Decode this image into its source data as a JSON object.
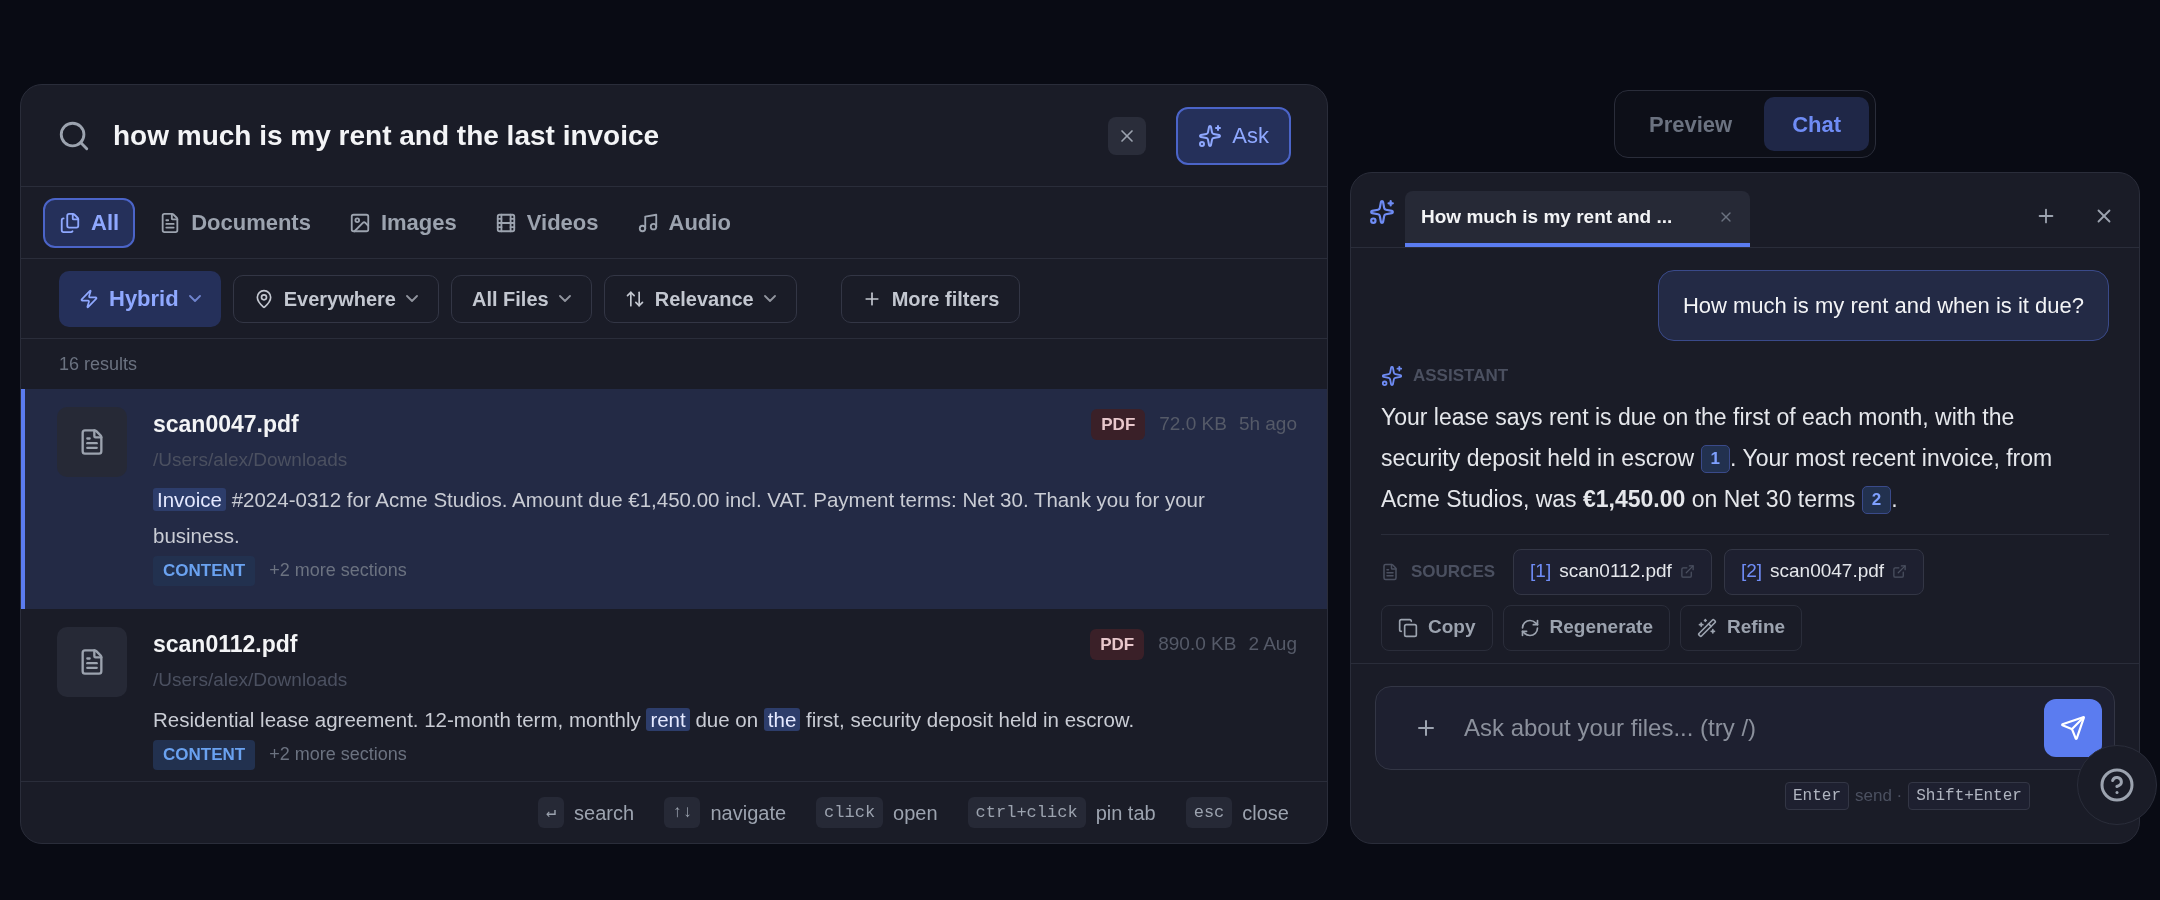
{
  "search": {
    "query": "how much is my rent and the last invoice",
    "ask_label": "Ask"
  },
  "type_tabs": [
    {
      "label": "All",
      "selected": true
    },
    {
      "label": "Documents",
      "selected": false
    },
    {
      "label": "Images",
      "selected": false
    },
    {
      "label": "Videos",
      "selected": false
    },
    {
      "label": "Audio",
      "selected": false
    }
  ],
  "filters": [
    {
      "label": "Hybrid",
      "kind": "dropdown",
      "selected": true
    },
    {
      "label": "Everywhere",
      "kind": "dropdown",
      "selected": false
    },
    {
      "label": "All Files",
      "kind": "dropdown",
      "selected": false
    },
    {
      "label": "Relevance",
      "kind": "dropdown",
      "selected": false
    },
    {
      "label": "More filters",
      "kind": "button",
      "selected": false
    }
  ],
  "result_count": "16 results",
  "results": [
    {
      "name": "scan0047.pdf",
      "path": "/Users/alex/Downloads",
      "type": "PDF",
      "size": "72.0 KB",
      "date": "5h ago",
      "selected": true,
      "snippet": [
        {
          "text": "Invoice",
          "highlight": true
        },
        {
          "text": " #2024-0312 for Acme Studios. Amount due €1,450.00 incl. VAT. Payment terms: Net 30. Thank you for your business.",
          "highlight": false
        }
      ],
      "tag": "CONTENT",
      "more": "+2 more sections"
    },
    {
      "name": "scan0112.pdf",
      "path": "/Users/alex/Downloads",
      "type": "PDF",
      "size": "890.0 KB",
      "date": "2 Aug",
      "selected": false,
      "snippet": [
        {
          "text": "Residential lease agreement. 12-month term, monthly ",
          "highlight": false
        },
        {
          "text": "rent",
          "highlight": true
        },
        {
          "text": " due on ",
          "highlight": false
        },
        {
          "text": "the",
          "highlight": true
        },
        {
          "text": " first, security deposit held in escrow.",
          "highlight": false
        }
      ],
      "tag": "CONTENT",
      "more": "+2 more sections"
    }
  ],
  "shortcuts": [
    {
      "key": "↵",
      "label": "search"
    },
    {
      "key": "↑↓",
      "label": "navigate"
    },
    {
      "key": "click",
      "label": "open"
    },
    {
      "key": "ctrl+click",
      "label": "pin tab"
    },
    {
      "key": "esc",
      "label": "close"
    }
  ],
  "view_toggle": [
    {
      "label": "Preview",
      "selected": false
    },
    {
      "label": "Chat",
      "selected": true
    }
  ],
  "chat": {
    "tab_title": "How much is my rent and ...",
    "user_message": "How much is my rent and when is it due?",
    "assistant_label": "ASSISTANT",
    "answer": [
      {
        "kind": "text",
        "text": "Your lease says rent is due on the first of each month, with the security deposit held in escrow "
      },
      {
        "kind": "cite",
        "text": "1"
      },
      {
        "kind": "text",
        "text": ". Your most recent invoice, from Acme Studios, was **€1,450.00** on Net 30 terms "
      },
      {
        "kind": "cite",
        "text": "2"
      },
      {
        "kind": "text",
        "text": "."
      }
    ],
    "sources_label": "SOURCES",
    "sources": [
      {
        "index": "[1]",
        "file": "scan0112.pdf"
      },
      {
        "index": "[2]",
        "file": "scan0047.pdf"
      }
    ],
    "actions": [
      {
        "label": "Copy"
      },
      {
        "label": "Regenerate"
      },
      {
        "label": "Refine"
      }
    ],
    "input_placeholder": "Ask about your files... (try /)",
    "hint": [
      {
        "kind": "key",
        "text": "Enter"
      },
      {
        "kind": "text",
        "text": "send ·"
      },
      {
        "kind": "key",
        "text": "Shift+Enter"
      }
    ]
  }
}
